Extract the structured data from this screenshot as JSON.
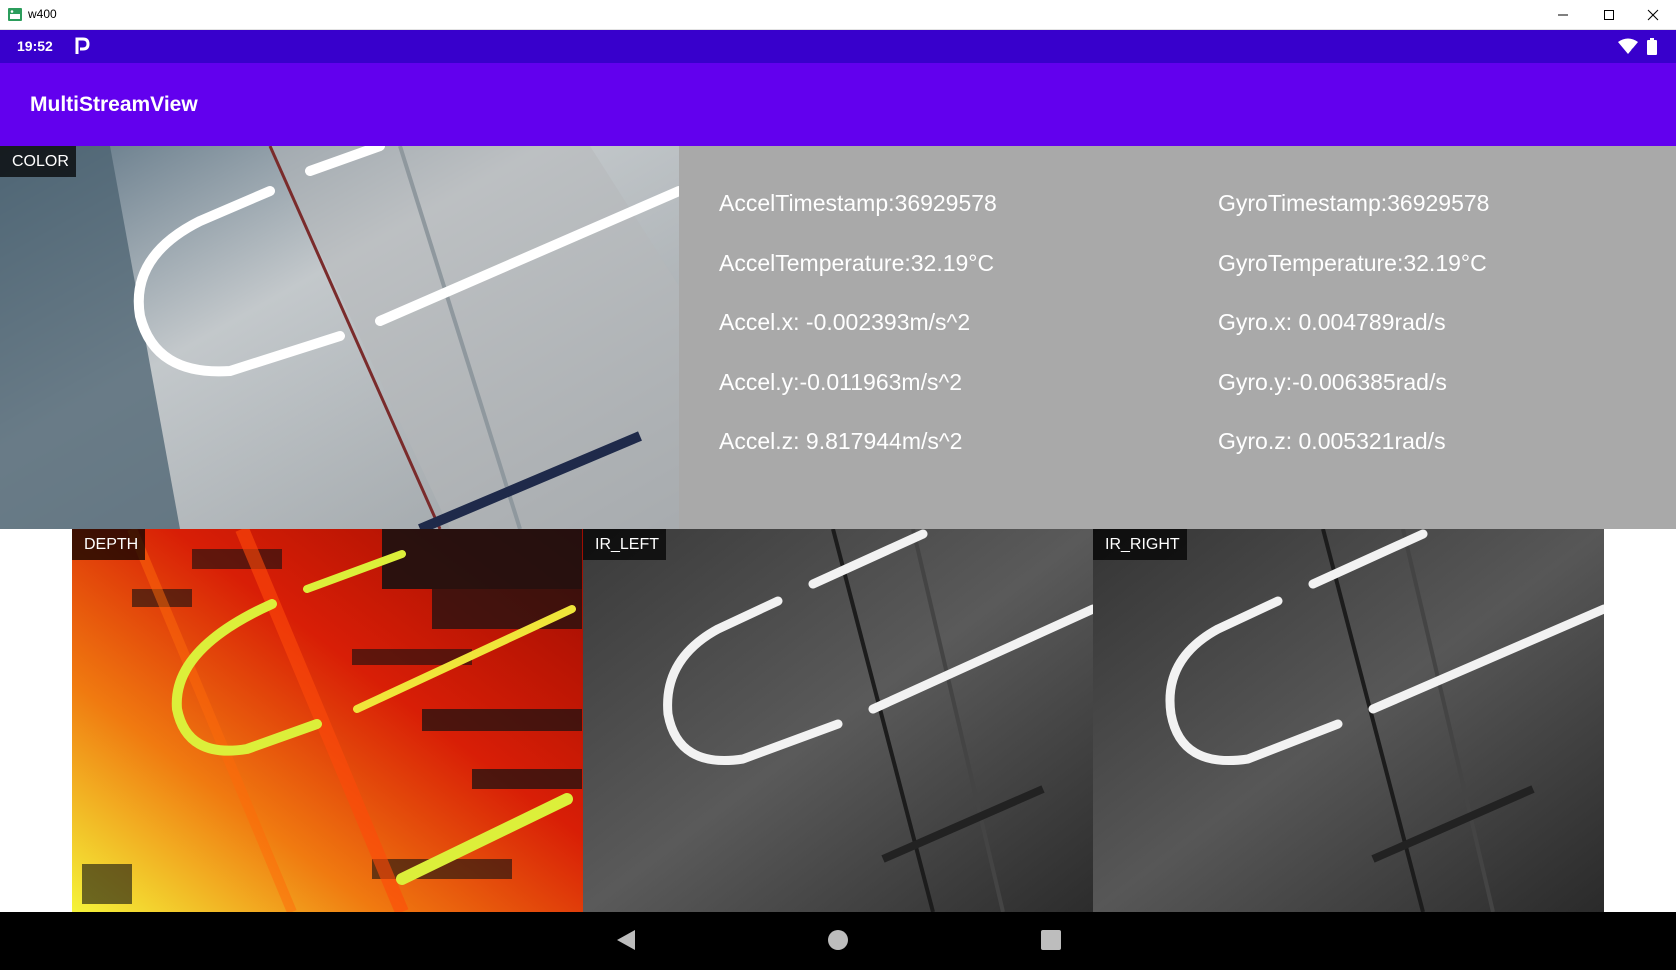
{
  "window": {
    "title": "w400",
    "controls": {
      "minimize_icon": "minimize-icon",
      "maximize_icon": "maximize-icon",
      "close_icon": "close-icon"
    }
  },
  "status_bar": {
    "time": "19:52",
    "icons": [
      "parking-p-icon",
      "wifi-icon",
      "battery-icon"
    ]
  },
  "app_bar": {
    "title": "MultiStreamView"
  },
  "streams": {
    "color": {
      "label": "COLOR"
    },
    "depth": {
      "label": "DEPTH"
    },
    "ir_left": {
      "label": "IR_LEFT"
    },
    "ir_right": {
      "label": "IR_RIGHT"
    }
  },
  "sensors": {
    "accel": {
      "timestamp": "AccelTimestamp:36929578",
      "temperature": "AccelTemperature:32.19°C",
      "x": "Accel.x: -0.002393m/s^2",
      "y": "Accel.y:-0.011963m/s^2",
      "z": "Accel.z: 9.817944m/s^2"
    },
    "gyro": {
      "timestamp": "GyroTimestamp:36929578",
      "temperature": "GyroTemperature:32.19°C",
      "x": "Gyro.x: 0.004789rad/s",
      "y": "Gyro.y:-0.006385rad/s",
      "z": "Gyro.z: 0.005321rad/s"
    }
  },
  "nav_bar": {
    "icons": [
      "back-icon",
      "home-icon",
      "recents-icon"
    ]
  },
  "colors": {
    "status_bar": "#3800cc",
    "app_bar": "#6200ee",
    "sensor_panel": "#a9a9a9",
    "nav_bar": "#000000"
  }
}
